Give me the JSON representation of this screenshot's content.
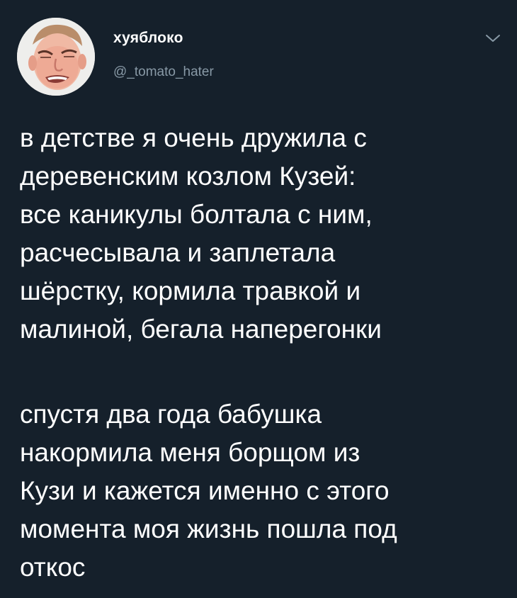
{
  "author": {
    "display_name": "хуяблоко",
    "handle": "@_tomato_hater",
    "avatar_icon": "user-avatar-face"
  },
  "menu": {
    "icon": "chevron-down-icon",
    "color": "#8899a6"
  },
  "tweet": {
    "paragraphs": [
      {
        "lines": [
          "в детстве я очень дружила с",
          "деревенским козлом Кузей:",
          "все каникулы болтала с ним,",
          "расчесывала и заплетала",
          "шёрстку, кормила травкой и",
          "малиной, бегала наперегонки"
        ]
      },
      {
        "lines": [
          "спустя два года бабушка",
          "накормила меня борщом из",
          "Кузи и кажется именно с этого",
          "момента моя жизнь пошла под",
          "откос"
        ]
      }
    ]
  },
  "colors": {
    "background": "#15202b",
    "text": "#ffffff",
    "secondary_text": "#8899a6"
  }
}
